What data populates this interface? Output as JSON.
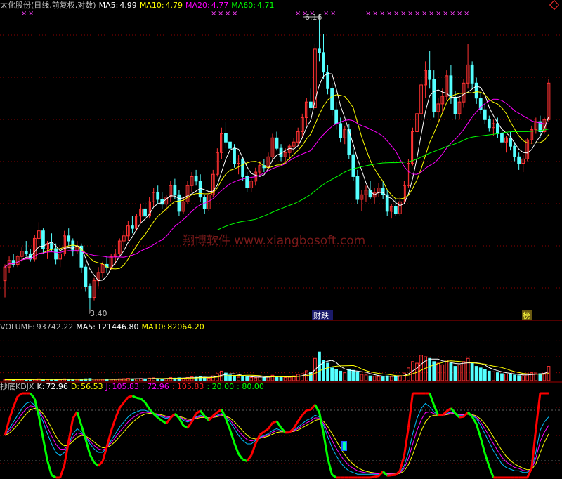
{
  "colors": {
    "background": "#000000",
    "up": "#ff3232",
    "down": "#54ffff",
    "ma5": "#ffffff",
    "ma10": "#ffff00",
    "ma20": "#ff00ff",
    "ma60": "#00ff00",
    "grid": "#8b0000",
    "k_up": "#ff0000",
    "k_down": "#00ff00"
  },
  "icons": {
    "close_icon": "diamond-icon"
  },
  "price_panel": {
    "title": "太化股份(日线,前复权,对数)",
    "ma5_label": "MA5:",
    "ma5_value": "4.99",
    "ma10_label": "MA10:",
    "ma10_value": "4.79",
    "ma20_label": "MA20:",
    "ma20_value": "4.77",
    "ma60_label": "MA60:",
    "ma60_value": "4.71",
    "high_label": "6.16",
    "low_label": "3.40",
    "watermark": "翔博软件 www.xiangbosoft.com",
    "marker_caidie": "财跌",
    "marker_bang": "榜"
  },
  "volume_panel": {
    "title": "VOLUME:",
    "value": "93742.22",
    "ma5_label": "MA5:",
    "ma5_value": "121446.80",
    "ma10_label": "MA10:",
    "ma10_value": "82064.20"
  },
  "kdj_panel": {
    "title": "抄底KDJX",
    "k_label": "K:",
    "k_value": "72.96",
    "d_label": "D:",
    "d_value": "56.53",
    "j_label": "J:",
    "j_value": "105.83",
    "v1": ": 72.96",
    "v2": ": 105.83",
    "v3": ": 20.00",
    "v4": ": 80.00"
  },
  "chart_data": {
    "type": "candlestick",
    "scale": "log",
    "price_ylim": [
      3.4,
      6.16
    ],
    "candles": [
      [
        3.6,
        3.72,
        3.48,
        3.7
      ],
      [
        3.7,
        3.78,
        3.66,
        3.75
      ],
      [
        3.75,
        3.8,
        3.7,
        3.72
      ],
      [
        3.72,
        3.79,
        3.7,
        3.78
      ],
      [
        3.78,
        3.85,
        3.74,
        3.82
      ],
      [
        3.82,
        3.9,
        3.78,
        3.8
      ],
      [
        3.8,
        3.84,
        3.74,
        3.76
      ],
      [
        3.76,
        3.95,
        3.74,
        3.92
      ],
      [
        3.92,
        4.05,
        3.88,
        3.98
      ],
      [
        3.98,
        4.0,
        3.8,
        3.84
      ],
      [
        3.84,
        3.9,
        3.76,
        3.88
      ],
      [
        3.88,
        3.96,
        3.82,
        3.84
      ],
      [
        3.84,
        3.88,
        3.72,
        3.76
      ],
      [
        3.76,
        3.82,
        3.7,
        3.8
      ],
      [
        3.8,
        3.98,
        3.78,
        3.94
      ],
      [
        3.94,
        4.0,
        3.86,
        3.9
      ],
      [
        3.9,
        3.92,
        3.78,
        3.82
      ],
      [
        3.82,
        3.9,
        3.8,
        3.86
      ],
      [
        3.86,
        3.88,
        3.66,
        3.7
      ],
      [
        3.7,
        3.72,
        3.52,
        3.56
      ],
      [
        3.56,
        3.58,
        3.4,
        3.48
      ],
      [
        3.48,
        3.62,
        3.46,
        3.6
      ],
      [
        3.6,
        3.7,
        3.56,
        3.66
      ],
      [
        3.66,
        3.74,
        3.62,
        3.72
      ],
      [
        3.72,
        3.78,
        3.66,
        3.7
      ],
      [
        3.7,
        3.8,
        3.68,
        3.78
      ],
      [
        3.78,
        3.84,
        3.72,
        3.8
      ],
      [
        3.8,
        3.92,
        3.78,
        3.9
      ],
      [
        3.9,
        3.98,
        3.84,
        3.94
      ],
      [
        3.94,
        4.06,
        3.9,
        4.02
      ],
      [
        4.02,
        4.1,
        3.96,
        4.0
      ],
      [
        4.0,
        4.12,
        3.98,
        4.1
      ],
      [
        4.1,
        4.2,
        4.04,
        4.16
      ],
      [
        4.16,
        4.22,
        4.06,
        4.1
      ],
      [
        4.1,
        4.26,
        4.08,
        4.22
      ],
      [
        4.22,
        4.34,
        4.18,
        4.3
      ],
      [
        4.3,
        4.36,
        4.2,
        4.24
      ],
      [
        4.24,
        4.3,
        4.16,
        4.2
      ],
      [
        4.2,
        4.28,
        4.14,
        4.26
      ],
      [
        4.26,
        4.4,
        4.22,
        4.36
      ],
      [
        4.36,
        4.42,
        4.24,
        4.28
      ],
      [
        4.28,
        4.32,
        4.1,
        4.14
      ],
      [
        4.14,
        4.26,
        4.12,
        4.22
      ],
      [
        4.22,
        4.4,
        4.2,
        4.36
      ],
      [
        4.36,
        4.48,
        4.3,
        4.44
      ],
      [
        4.44,
        4.5,
        4.36,
        4.4
      ],
      [
        4.4,
        4.46,
        4.22,
        4.26
      ],
      [
        4.26,
        4.28,
        4.12,
        4.16
      ],
      [
        4.16,
        4.3,
        4.14,
        4.28
      ],
      [
        4.28,
        4.5,
        4.26,
        4.46
      ],
      [
        4.46,
        4.7,
        4.44,
        4.66
      ],
      [
        4.66,
        4.9,
        4.6,
        4.84
      ],
      [
        4.84,
        4.96,
        4.7,
        4.76
      ],
      [
        4.76,
        4.82,
        4.62,
        4.7
      ],
      [
        4.7,
        4.74,
        4.52,
        4.56
      ],
      [
        4.56,
        4.64,
        4.46,
        4.6
      ],
      [
        4.6,
        4.62,
        4.4,
        4.44
      ],
      [
        4.44,
        4.48,
        4.3,
        4.34
      ],
      [
        4.34,
        4.42,
        4.3,
        4.4
      ],
      [
        4.4,
        4.52,
        4.36,
        4.48
      ],
      [
        4.48,
        4.58,
        4.44,
        4.54
      ],
      [
        4.54,
        4.6,
        4.48,
        4.52
      ],
      [
        4.52,
        4.66,
        4.5,
        4.62
      ],
      [
        4.62,
        4.84,
        4.58,
        4.8
      ],
      [
        4.8,
        4.86,
        4.68,
        4.7
      ],
      [
        4.7,
        4.74,
        4.58,
        4.62
      ],
      [
        4.62,
        4.7,
        4.56,
        4.66
      ],
      [
        4.66,
        4.74,
        4.6,
        4.72
      ],
      [
        4.72,
        4.8,
        4.66,
        4.76
      ],
      [
        4.76,
        4.9,
        4.72,
        4.86
      ],
      [
        4.86,
        5.04,
        4.8,
        5.0
      ],
      [
        5.0,
        5.2,
        4.92,
        5.16
      ],
      [
        5.16,
        5.3,
        5.06,
        5.1
      ],
      [
        5.1,
        5.8,
        5.08,
        5.74
      ],
      [
        5.74,
        6.16,
        5.6,
        5.7
      ],
      [
        5.7,
        5.92,
        5.4,
        5.48
      ],
      [
        5.48,
        5.56,
        5.24,
        5.3
      ],
      [
        5.3,
        5.36,
        5.02,
        5.08
      ],
      [
        5.08,
        5.16,
        4.88,
        4.94
      ],
      [
        4.94,
        5.0,
        4.76,
        4.8
      ],
      [
        4.8,
        4.92,
        4.74,
        4.88
      ],
      [
        4.88,
        4.94,
        4.6,
        4.64
      ],
      [
        4.64,
        4.7,
        4.4,
        4.44
      ],
      [
        4.44,
        4.5,
        4.2,
        4.24
      ],
      [
        4.24,
        4.32,
        4.14,
        4.28
      ],
      [
        4.28,
        4.36,
        4.22,
        4.32
      ],
      [
        4.32,
        4.4,
        4.24,
        4.26
      ],
      [
        4.26,
        4.34,
        4.2,
        4.3
      ],
      [
        4.3,
        4.38,
        4.26,
        4.34
      ],
      [
        4.34,
        4.4,
        4.24,
        4.28
      ],
      [
        4.28,
        4.32,
        4.1,
        4.14
      ],
      [
        4.14,
        4.2,
        4.08,
        4.18
      ],
      [
        4.18,
        4.24,
        4.1,
        4.12
      ],
      [
        4.12,
        4.26,
        4.1,
        4.22
      ],
      [
        4.22,
        4.4,
        4.2,
        4.36
      ],
      [
        4.36,
        4.6,
        4.34,
        4.56
      ],
      [
        4.56,
        4.9,
        4.54,
        4.86
      ],
      [
        4.86,
        5.1,
        4.8,
        5.04
      ],
      [
        5.04,
        5.4,
        4.98,
        5.34
      ],
      [
        5.34,
        5.6,
        5.2,
        5.5
      ],
      [
        5.5,
        5.72,
        5.3,
        5.4
      ],
      [
        5.4,
        5.5,
        5.0,
        5.06
      ],
      [
        5.06,
        5.2,
        4.94,
        5.14
      ],
      [
        5.14,
        5.3,
        5.06,
        5.22
      ],
      [
        5.22,
        5.5,
        5.18,
        5.44
      ],
      [
        5.44,
        5.56,
        5.14,
        5.2
      ],
      [
        5.2,
        5.28,
        4.98,
        5.04
      ],
      [
        5.04,
        5.2,
        4.98,
        5.16
      ],
      [
        5.16,
        5.4,
        5.1,
        5.36
      ],
      [
        5.36,
        5.8,
        5.3,
        5.56
      ],
      [
        5.56,
        5.6,
        5.3,
        5.36
      ],
      [
        5.36,
        5.42,
        5.14,
        5.2
      ],
      [
        5.2,
        5.26,
        5.04,
        5.08
      ],
      [
        5.08,
        5.14,
        4.94,
        4.98
      ],
      [
        4.98,
        5.02,
        4.86,
        4.9
      ],
      [
        4.9,
        4.98,
        4.82,
        4.94
      ],
      [
        4.94,
        5.0,
        4.8,
        4.84
      ],
      [
        4.84,
        4.88,
        4.7,
        4.76
      ],
      [
        4.76,
        4.82,
        4.66,
        4.8
      ],
      [
        4.8,
        4.86,
        4.68,
        4.72
      ],
      [
        4.72,
        4.76,
        4.58,
        4.62
      ],
      [
        4.62,
        4.66,
        4.5,
        4.56
      ],
      [
        4.56,
        4.64,
        4.48,
        4.6
      ],
      [
        4.6,
        4.8,
        4.58,
        4.78
      ],
      [
        4.78,
        4.92,
        4.74,
        4.88
      ],
      [
        4.88,
        5.0,
        4.84,
        4.96
      ],
      [
        4.96,
        5.02,
        4.8,
        4.86
      ],
      [
        4.86,
        5.0,
        4.84,
        4.98
      ],
      [
        4.98,
        5.4,
        4.96,
        5.36
      ]
    ],
    "volume_ylim": [
      0,
      300000
    ],
    "volume": [
      6,
      7,
      6,
      8,
      9,
      7,
      6,
      10,
      12,
      8,
      7,
      6,
      7,
      8,
      12,
      10,
      7,
      8,
      9,
      12,
      14,
      10,
      9,
      8,
      7,
      8,
      9,
      12,
      13,
      15,
      11,
      12,
      14,
      10,
      16,
      18,
      12,
      11,
      13,
      20,
      16,
      18,
      14,
      20,
      24,
      22,
      26,
      18,
      16,
      30,
      44,
      60,
      48,
      36,
      30,
      22,
      28,
      24,
      20,
      18,
      26,
      22,
      24,
      34,
      28,
      22,
      20,
      22,
      30,
      40,
      44,
      62,
      55,
      140,
      180,
      130,
      110,
      80,
      70,
      60,
      50,
      70,
      65,
      55,
      40,
      36,
      30,
      28,
      26,
      24,
      30,
      28,
      26,
      32,
      48,
      80,
      120,
      110,
      160,
      150,
      140,
      120,
      110,
      100,
      130,
      110,
      90,
      100,
      120,
      140,
      110,
      90,
      80,
      70,
      60,
      56,
      50,
      44,
      42,
      40,
      36,
      32,
      30,
      44,
      50,
      48,
      44,
      46,
      90
    ],
    "kdj_ylim": [
      0,
      100
    ],
    "k": [
      50,
      58,
      66,
      74,
      82,
      88,
      90,
      86,
      78,
      66,
      52,
      40,
      30,
      26,
      30,
      40,
      52,
      58,
      54,
      48,
      40,
      34,
      30,
      30,
      36,
      44,
      52,
      60,
      66,
      72,
      76,
      78,
      80,
      80,
      78,
      76,
      74,
      72,
      70,
      72,
      74,
      72,
      68,
      66,
      68,
      72,
      74,
      72,
      70,
      72,
      74,
      76,
      72,
      66,
      58,
      50,
      44,
      40,
      40,
      44,
      48,
      50,
      52,
      56,
      58,
      56,
      54,
      54,
      56,
      60,
      64,
      68,
      70,
      74,
      72,
      62,
      48,
      36,
      26,
      18,
      12,
      8,
      6,
      4,
      4,
      4,
      4,
      4,
      4,
      6,
      4,
      4,
      4,
      6,
      14,
      30,
      52,
      70,
      82,
      88,
      84,
      78,
      74,
      74,
      76,
      78,
      76,
      74,
      74,
      76,
      74,
      70,
      62,
      52,
      42,
      32,
      24,
      16,
      12,
      10,
      8,
      8,
      6,
      6,
      10,
      30,
      56,
      66,
      72
    ]
  }
}
